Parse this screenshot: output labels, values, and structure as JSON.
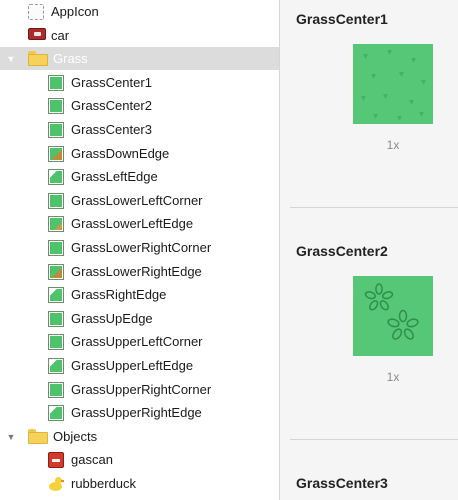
{
  "sidebar": {
    "rows": [
      {
        "label": "AppIcon",
        "icon": "appicon-icon",
        "kind": "appicon",
        "indent": 0
      },
      {
        "label": "car",
        "icon": "car-icon",
        "kind": "car",
        "indent": 0
      },
      {
        "label": "Grass",
        "icon": "folder-icon",
        "kind": "folder",
        "indent": 0,
        "expanded": true,
        "selected": true
      },
      {
        "label": "GrassCenter1",
        "icon": "image-icon",
        "kind": "img",
        "indent": 1
      },
      {
        "label": "GrassCenter2",
        "icon": "image-icon",
        "kind": "img",
        "indent": 1
      },
      {
        "label": "GrassCenter3",
        "icon": "image-icon",
        "kind": "img",
        "indent": 1
      },
      {
        "label": "GrassDownEdge",
        "icon": "image-icon",
        "kind": "img-brown",
        "indent": 1
      },
      {
        "label": "GrassLeftEdge",
        "icon": "image-icon",
        "kind": "img-corner",
        "indent": 1
      },
      {
        "label": "GrassLowerLeftCorner",
        "icon": "image-icon",
        "kind": "img",
        "indent": 1
      },
      {
        "label": "GrassLowerLeftEdge",
        "icon": "image-icon",
        "kind": "img-sand",
        "indent": 1
      },
      {
        "label": "GrassLowerRightCorner",
        "icon": "image-icon",
        "kind": "img",
        "indent": 1
      },
      {
        "label": "GrassLowerRightEdge",
        "icon": "image-icon",
        "kind": "img-brown",
        "indent": 1
      },
      {
        "label": "GrassRightEdge",
        "icon": "image-icon",
        "kind": "img-corner",
        "indent": 1
      },
      {
        "label": "GrassUpEdge",
        "icon": "image-icon",
        "kind": "img",
        "indent": 1
      },
      {
        "label": "GrassUpperLeftCorner",
        "icon": "image-icon",
        "kind": "img",
        "indent": 1
      },
      {
        "label": "GrassUpperLeftEdge",
        "icon": "image-icon",
        "kind": "img-corner",
        "indent": 1
      },
      {
        "label": "GrassUpperRightCorner",
        "icon": "image-icon",
        "kind": "img",
        "indent": 1
      },
      {
        "label": "GrassUpperRightEdge",
        "icon": "image-icon",
        "kind": "img-corner",
        "indent": 1
      },
      {
        "label": "Objects",
        "icon": "folder-icon",
        "kind": "folder",
        "indent": 0,
        "expanded": true
      },
      {
        "label": "gascan",
        "icon": "gascan-icon",
        "kind": "gascan",
        "indent": 1
      },
      {
        "label": "rubberduck",
        "icon": "duck-icon",
        "kind": "duck",
        "indent": 1
      }
    ]
  },
  "detail": {
    "groups": [
      {
        "title": "GrassCenter1",
        "scale": "1x",
        "pattern": "small"
      },
      {
        "title": "GrassCenter2",
        "scale": "1x",
        "pattern": "leaf"
      },
      {
        "title": "GrassCenter3",
        "scale": "",
        "pattern": "none"
      }
    ]
  },
  "colors": {
    "selection": "#dcdcdc",
    "grass": "#55c776",
    "folder": "#f7d25a"
  }
}
